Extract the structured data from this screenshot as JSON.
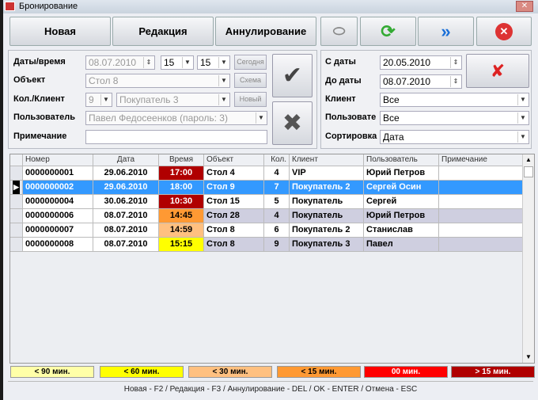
{
  "title": "Бронирование",
  "toolbar": {
    "new": "Новая",
    "edit": "Редакция",
    "cancel": "Аннулирование"
  },
  "form": {
    "datetime_label": "Даты/время",
    "date": "08.07.2010",
    "hour": "15",
    "minute": "15",
    "today": "Сегодня",
    "object_label": "Объект",
    "object": "Стол 8",
    "scheme": "Схема",
    "qty_client_label": "Кол./Клиент",
    "qty": "9",
    "client": "Покупатель 3",
    "new_client": "Новый",
    "user_label": "Пользователь",
    "user": "Павел Федосеенков (пароль: 3)",
    "note_label": "Примечание",
    "note": ""
  },
  "filter": {
    "from_label": "С даты",
    "from": "20.05.2010",
    "to_label": "До даты",
    "to": "08.07.2010",
    "client_label": "Клиент",
    "client": "Все",
    "user_label": "Пользовате",
    "user": "Все",
    "sort_label": "Сортировка",
    "sort": "Дата"
  },
  "table": {
    "headers": [
      "Номер",
      "Дата",
      "Время",
      "Объект",
      "Кол.",
      "Клиент",
      "Пользователь",
      "Примечание"
    ],
    "rows": [
      {
        "num": "0000000001",
        "date": "29.06.2010",
        "time": "17:00",
        "obj": "Стол 4",
        "qty": "4",
        "client": "VIP",
        "user": "Юрий Петров",
        "note": "",
        "time_color": "#b00000",
        "time_text": "#ffffff",
        "row_bg": "#ffffff"
      },
      {
        "num": "0000000002",
        "date": "29.06.2010",
        "time": "18:00",
        "obj": "Стол 9",
        "qty": "7",
        "client": "Покупатель 2",
        "user": "Сергей Осин",
        "note": "",
        "time_color": "#3399ff",
        "time_text": "#ffffff",
        "row_bg": "#3399ff",
        "selected": true
      },
      {
        "num": "0000000004",
        "date": "30.06.2010",
        "time": "10:30",
        "obj": "Стол 15",
        "qty": "5",
        "client": "Покупатель",
        "user": "Сергей",
        "note": "",
        "time_color": "#b00000",
        "time_text": "#ffffff",
        "row_bg": "#ffffff"
      },
      {
        "num": "0000000006",
        "date": "08.07.2010",
        "time": "14:45",
        "obj": "Стол 28",
        "qty": "4",
        "client": "Покупатель",
        "user": "Юрий Петров",
        "note": "",
        "time_color": "#ff9933",
        "time_text": "#000000",
        "row_bg": "#cfcfe0"
      },
      {
        "num": "0000000007",
        "date": "08.07.2010",
        "time": "14:59",
        "obj": "Стол 8",
        "qty": "6",
        "client": "Покупатель 2",
        "user": "Станислав",
        "note": "",
        "time_color": "#ffc080",
        "time_text": "#000000",
        "row_bg": "#ffffff"
      },
      {
        "num": "0000000008",
        "date": "08.07.2010",
        "time": "15:15",
        "obj": "Стол 8",
        "qty": "9",
        "client": "Покупатель 3",
        "user": "Павел",
        "note": "",
        "time_color": "#ffff00",
        "time_text": "#000000",
        "row_bg": "#cfcfe0"
      }
    ]
  },
  "legend": [
    {
      "label": "< 90 мин.",
      "color": "#ffffa8",
      "text": "#000000"
    },
    {
      "label": "< 60 мин.",
      "color": "#ffff00",
      "text": "#000000"
    },
    {
      "label": "< 30 мин.",
      "color": "#ffc080",
      "text": "#000000"
    },
    {
      "label": "< 15 мин.",
      "color": "#ff9933",
      "text": "#000000"
    },
    {
      "label": "00 мин.",
      "color": "#ff0000",
      "text": "#ffffff"
    },
    {
      "label": "> 15 мин.",
      "color": "#b00000",
      "text": "#ffffff"
    }
  ],
  "footer": "Новая - F2 / Редакция - F3 / Аннулирование - DEL /  OK - ENTER / Отмена - ESC"
}
